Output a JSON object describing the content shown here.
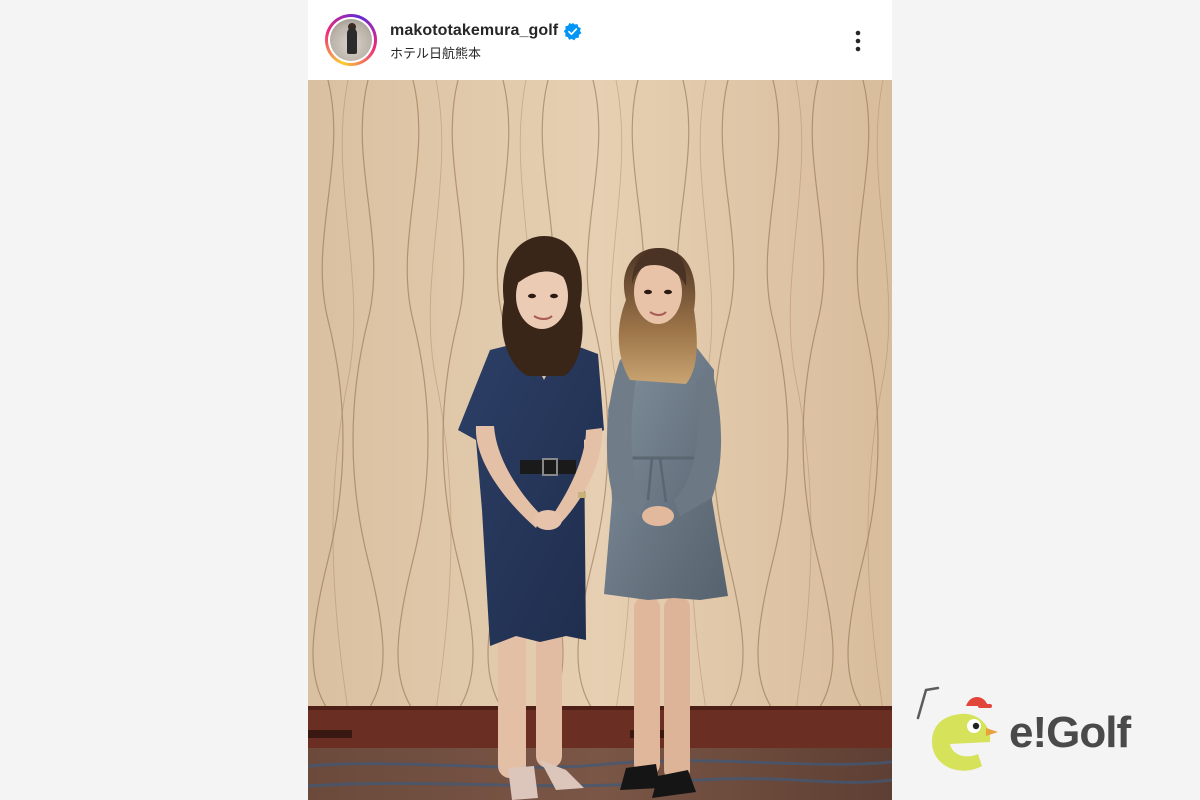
{
  "post": {
    "username": "makototakemura_golf",
    "verified": true,
    "location": "ホテル日航熊本",
    "more_icon": "more-vertical-icon"
  },
  "photo": {
    "subject": "two women standing in front of a patterned beige wall"
  },
  "branding": {
    "logo_text": "e!Golf",
    "colors": {
      "mascot": "#d6e25a",
      "logo_text": "#4a4a4a",
      "verified": "#0095f6"
    }
  }
}
